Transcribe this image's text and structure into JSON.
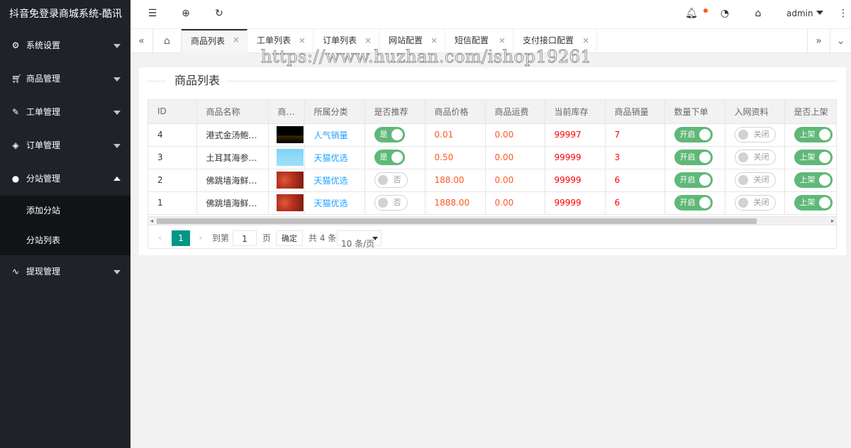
{
  "app": {
    "title": "抖音免登录商城系统-酷讯"
  },
  "sidebar": {
    "items": [
      {
        "label": "系统设置",
        "icon": "gear-icon"
      },
      {
        "label": "商品管理",
        "icon": "cart-icon"
      },
      {
        "label": "工单管理",
        "icon": "ticket-icon"
      },
      {
        "label": "订单管理",
        "icon": "layers-icon"
      },
      {
        "label": "分站管理",
        "icon": "globe-icon",
        "expanded": true
      },
      {
        "label": "提现管理",
        "icon": "pulse-icon"
      }
    ],
    "subitems": [
      {
        "label": "添加分站"
      },
      {
        "label": "分站列表"
      }
    ]
  },
  "header": {
    "user": "admin",
    "colors": {
      "notify_dot": "#ff5722"
    }
  },
  "tabs": [
    {
      "label": "商品列表",
      "active": true
    },
    {
      "label": "工单列表"
    },
    {
      "label": "订单列表"
    },
    {
      "label": "网站配置"
    },
    {
      "label": "短信配置"
    },
    {
      "label": "支付接口配置"
    }
  ],
  "watermark": "https://www.huzhan.com/ishop19261",
  "card": {
    "title": "商品列表"
  },
  "table": {
    "columns": [
      "ID",
      "商品名称",
      "商…",
      "所属分类",
      "是否推荐",
      "商品价格",
      "商品运费",
      "当前库存",
      "商品销量",
      "数量下单",
      "入网资料",
      "是否上架"
    ],
    "rows": [
      {
        "id": "4",
        "name": "港式金汤鲍…",
        "thumb": "dark",
        "category": "人气销量",
        "recommend": "是",
        "recommend_on": true,
        "price": "0.01",
        "shipping": "0.00",
        "stock": "99997",
        "sales": "7",
        "qty": "开启",
        "qty_on": true,
        "netinfo": "关闭",
        "netinfo_on": false,
        "listed": "上架",
        "listed_on": true
      },
      {
        "id": "3",
        "name": "土耳其海参…",
        "thumb": "blue",
        "category": "天猫优选",
        "recommend": "是",
        "recommend_on": true,
        "price": "0.50",
        "shipping": "0.00",
        "stock": "99999",
        "sales": "3",
        "qty": "开启",
        "qty_on": true,
        "netinfo": "关闭",
        "netinfo_on": false,
        "listed": "上架",
        "listed_on": true
      },
      {
        "id": "2",
        "name": "佛跳墙海鲜…",
        "thumb": "red",
        "category": "天猫优选",
        "recommend": "否",
        "recommend_on": false,
        "price": "188.00",
        "shipping": "0.00",
        "stock": "99999",
        "sales": "6",
        "qty": "开启",
        "qty_on": true,
        "netinfo": "关闭",
        "netinfo_on": false,
        "listed": "上架",
        "listed_on": true
      },
      {
        "id": "1",
        "name": "佛跳墙海鲜…",
        "thumb": "red",
        "category": "天猫优选",
        "recommend": "否",
        "recommend_on": false,
        "price": "1888.00",
        "shipping": "0.00",
        "stock": "99999",
        "sales": "6",
        "qty": "开启",
        "qty_on": true,
        "netinfo": "关闭",
        "netinfo_on": false,
        "listed": "上架",
        "listed_on": true
      }
    ]
  },
  "pager": {
    "current": "1",
    "jump_label": "到第",
    "page_input": "1",
    "page_label": "页",
    "ok_label": "确定",
    "total": "共 4 条",
    "page_size": "10 条/页"
  }
}
